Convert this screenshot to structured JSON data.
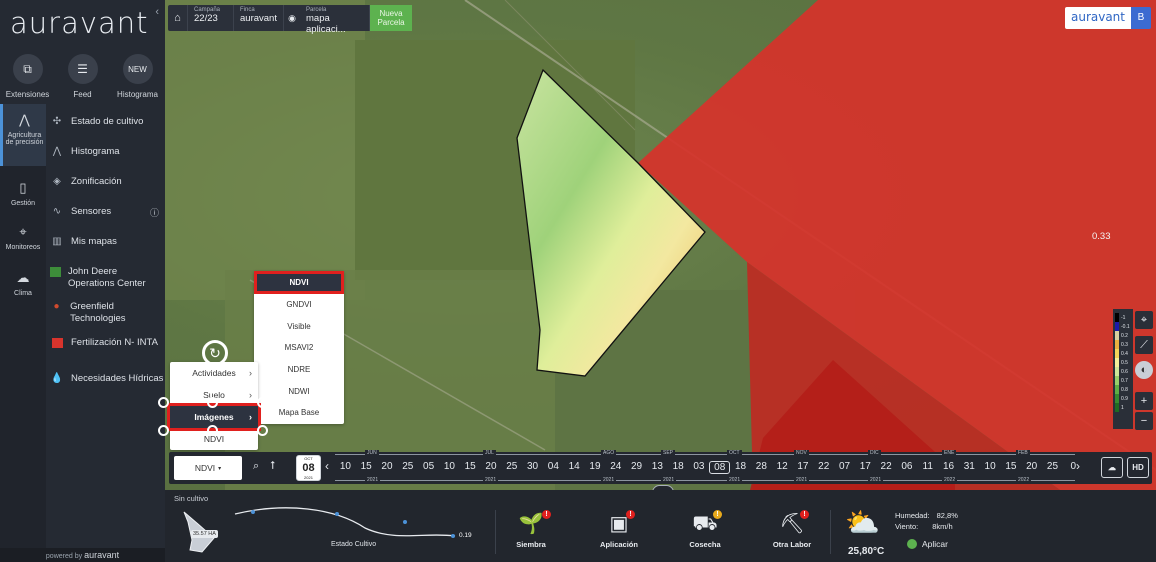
{
  "sidebar": {
    "brand": "auravant",
    "collapse_icon": "chevron-left",
    "top_items": [
      {
        "label": "Extensiones",
        "icon": "puzzle-icon"
      },
      {
        "label": "Feed",
        "icon": "chat-icon"
      },
      {
        "label": "Histograma",
        "icon_text": "NEW"
      }
    ],
    "rail": [
      {
        "label": "Agricultura de precisión",
        "icon": "pulse-icon"
      },
      {
        "label": "Gestión",
        "icon": "clipboard-icon"
      },
      {
        "label": "Monitoreos",
        "icon": "pin-icon"
      },
      {
        "label": "Clima",
        "icon": "cloud-icon"
      }
    ],
    "menu": [
      {
        "label": "Estado de cultivo",
        "icon": "sprout-icon"
      },
      {
        "label": "Histograma",
        "icon": "curve-icon"
      },
      {
        "label": "Zonificación",
        "icon": "layers-icon"
      },
      {
        "label": "Sensores",
        "icon": "signal-icon",
        "info": "ⓘ"
      },
      {
        "label": "Mis mapas",
        "icon": "map-icon"
      },
      {
        "label": "John Deere Operations Center",
        "icon": "john-deere-logo"
      },
      {
        "label": "Greenfield Technologies",
        "icon": "greenfield-logo"
      },
      {
        "label": "Fertilización N- INTA",
        "icon": "inta-logo"
      },
      {
        "label": "Necesidades Hídricas",
        "icon": "water-drop-icon"
      }
    ],
    "powered_prefix": "powered by",
    "powered_brand": "auravant"
  },
  "topbar": {
    "campaign_label": "Campaña",
    "campaign_value": "22/23",
    "farm_label": "Finca",
    "farm_value": "auravant",
    "parcel_label": "Parcela",
    "parcel_value": "mapa aplicaci...",
    "new_parcel_line1": "Nueva",
    "new_parcel_line2": "Parcela"
  },
  "top_right_logo": {
    "brand": "auravant",
    "user_initial": "B"
  },
  "map": {
    "value_label": "0.33"
  },
  "legend": {
    "entries": [
      {
        "label": "-1",
        "color": "#000000"
      },
      {
        "label": "-0.1",
        "color": "#1a1aa8"
      },
      {
        "label": "0.2",
        "color": "#d8d0a0"
      },
      {
        "label": "0.3",
        "color": "#e8b140"
      },
      {
        "label": "0.4",
        "color": "#f2d45a"
      },
      {
        "label": "0.5",
        "color": "#f4ef9a"
      },
      {
        "label": "0.6",
        "color": "#cfe69a"
      },
      {
        "label": "0.7",
        "color": "#98ce6a"
      },
      {
        "label": "0.8",
        "color": "#5fae45"
      },
      {
        "label": "0.9",
        "color": "#378a2f"
      },
      {
        "label": "1",
        "color": "#1f6b22"
      }
    ]
  },
  "map_controls": {
    "zoom_in": "+",
    "zoom_out": "−"
  },
  "submenu": [
    {
      "label": "Actividades",
      "has_arrow": true
    },
    {
      "label": "Suelo",
      "has_arrow": true
    },
    {
      "label": "Imágenes",
      "has_arrow": true
    },
    {
      "label": "NDVI",
      "has_arrow": false
    }
  ],
  "image_list": [
    "NDVI",
    "GNDVI",
    "Visible",
    "MSAVI2",
    "NDRE",
    "NDWI",
    "Mapa Base"
  ],
  "timeline": {
    "selected_index": "NDVI",
    "cal_month": "OCT",
    "cal_day": "08",
    "cal_year": "2021",
    "days": [
      "10",
      "15",
      "20",
      "25",
      "05",
      "10",
      "15",
      "20",
      "25",
      "30",
      "04",
      "14",
      "19",
      "24",
      "29",
      "13",
      "18",
      "03",
      "08",
      "18",
      "28",
      "12",
      "17",
      "22",
      "07",
      "17",
      "22",
      "06",
      "11",
      "16",
      "31",
      "10",
      "15",
      "20",
      "25",
      "0"
    ],
    "current_day": "08",
    "months": [
      {
        "label": "JUN",
        "pos": 0.04
      },
      {
        "label": "JUL",
        "pos": 0.2
      },
      {
        "label": "AGO",
        "pos": 0.36
      },
      {
        "label": "SEP",
        "pos": 0.44
      },
      {
        "label": "OCT",
        "pos": 0.53
      },
      {
        "label": "NOV",
        "pos": 0.62
      },
      {
        "label": "DIC",
        "pos": 0.72
      },
      {
        "label": "ENE",
        "pos": 0.82
      },
      {
        "label": "FEB",
        "pos": 0.92
      }
    ],
    "years": [
      {
        "label": "2021",
        "pos": 0.04
      },
      {
        "label": "2021",
        "pos": 0.2
      },
      {
        "label": "2021",
        "pos": 0.36
      },
      {
        "label": "2021",
        "pos": 0.44
      },
      {
        "label": "2021",
        "pos": 0.53
      },
      {
        "label": "2021",
        "pos": 0.62
      },
      {
        "label": "2021",
        "pos": 0.72
      },
      {
        "label": "2022",
        "pos": 0.82
      },
      {
        "label": "2022",
        "pos": 0.92
      }
    ],
    "hd_label": "HD"
  },
  "bottom": {
    "crop_status_title": "Sin cultivo",
    "area_badge": "35.57 HA",
    "crop_curve_label": "Estado Cultivo",
    "crop_curve_value": "0.19",
    "actions": [
      {
        "label": "Siembra",
        "badge": "!",
        "badge_color": "#e0201e"
      },
      {
        "label": "Aplicación",
        "badge": "!",
        "badge_color": "#e0201e"
      },
      {
        "label": "Cosecha",
        "badge": "!",
        "badge_color": "#e8a91c"
      },
      {
        "label": "Otra Labor",
        "badge": "!",
        "badge_color": "#e0201e"
      }
    ],
    "weather": {
      "temperature": "25,80°C",
      "humidity_label": "Humedad:",
      "humidity_value": "82,8%",
      "wind_label": "Viento:",
      "wind_value": "8km/h",
      "apply_label": "Aplicar"
    }
  }
}
